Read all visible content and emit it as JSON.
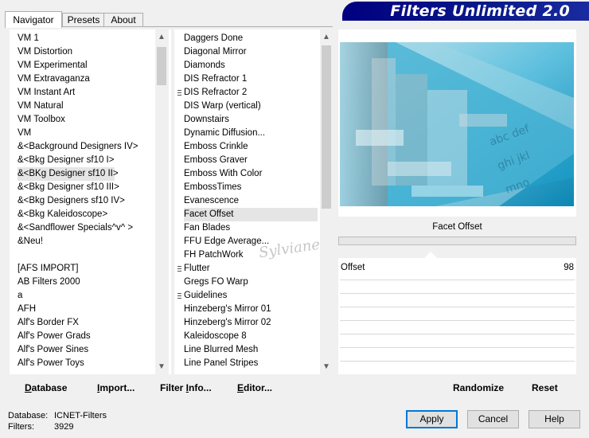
{
  "app": {
    "title": "Filters Unlimited 2.0"
  },
  "tabs": [
    {
      "label": "Navigator",
      "active": true
    },
    {
      "label": "Presets",
      "active": false
    },
    {
      "label": "About",
      "active": false
    }
  ],
  "categories": {
    "items": [
      {
        "label": "VM 1"
      },
      {
        "label": "VM Distortion"
      },
      {
        "label": "VM Experimental"
      },
      {
        "label": "VM Extravaganza"
      },
      {
        "label": "VM Instant Art"
      },
      {
        "label": "VM Natural"
      },
      {
        "label": "VM Toolbox"
      },
      {
        "label": "VM"
      },
      {
        "label": "&<Background Designers IV>"
      },
      {
        "label": "&<Bkg Designer sf10 I>"
      },
      {
        "label": "&<BKg Designer sf10 II>",
        "selected": true
      },
      {
        "label": "&<Bkg Designer sf10 III>"
      },
      {
        "label": "&<Bkg Designers sf10 IV>"
      },
      {
        "label": "&<Bkg Kaleidoscope>"
      },
      {
        "label": "&<Sandflower Specials^v^ >"
      },
      {
        "label": "&Neu!"
      },
      {
        "label": ""
      },
      {
        "label": "[AFS IMPORT]"
      },
      {
        "label": "AB Filters 2000"
      },
      {
        "label": "a"
      },
      {
        "label": "AFH"
      },
      {
        "label": "Alf's Border FX"
      },
      {
        "label": "Alf's Power Grads"
      },
      {
        "label": "Alf's Power Sines"
      },
      {
        "label": "Alf's Power Toys"
      }
    ]
  },
  "filters": {
    "items": [
      {
        "label": "Daggers Done"
      },
      {
        "label": "Diagonal Mirror"
      },
      {
        "label": "Diamonds"
      },
      {
        "label": "DIS Refractor 1"
      },
      {
        "label": "DIS Refractor 2",
        "marker": true
      },
      {
        "label": "DIS Warp (vertical)"
      },
      {
        "label": "Downstairs"
      },
      {
        "label": "Dynamic Diffusion..."
      },
      {
        "label": "Emboss Crinkle"
      },
      {
        "label": "Emboss Graver"
      },
      {
        "label": "Emboss With Color"
      },
      {
        "label": "EmbossTimes"
      },
      {
        "label": "Evanescence"
      },
      {
        "label": "Facet Offset",
        "selected": true
      },
      {
        "label": "Fan Blades"
      },
      {
        "label": "FFU Edge Average..."
      },
      {
        "label": "FH PatchWork"
      },
      {
        "label": "Flutter",
        "marker": true
      },
      {
        "label": "Gregs FO Warp"
      },
      {
        "label": "Guidelines",
        "marker": true
      },
      {
        "label": "Hinzeberg's Mirror 01"
      },
      {
        "label": "Hinzeberg's Mirror 02"
      },
      {
        "label": "Kaleidoscope 8"
      },
      {
        "label": "Line Blurred Mesh"
      },
      {
        "label": "Line Panel Stripes"
      }
    ]
  },
  "preview": {
    "filter_name": "Facet Offset",
    "watermark": "Sylviane"
  },
  "params": [
    {
      "label": "Offset",
      "value": "98"
    }
  ],
  "link_buttons": {
    "database": {
      "underline": "D",
      "rest": "atabase"
    },
    "import": {
      "underline": "I",
      "rest": "mport..."
    },
    "filter_info": {
      "pre": "Filter ",
      "underline": "I",
      "rest": "nfo..."
    },
    "editor": {
      "underline": "E",
      "rest": "ditor..."
    },
    "randomize": "Randomize",
    "reset": "Reset"
  },
  "status": {
    "database_label": "Database:",
    "database_value": "ICNET-Filters",
    "filters_label": "Filters:",
    "filters_value": "3929"
  },
  "buttons": {
    "apply": "Apply",
    "cancel": "Cancel",
    "help": "Help"
  },
  "colors": {
    "banner": "#000080",
    "default_border": "#0078d7",
    "preview_cyan": "#1f9ec8"
  }
}
